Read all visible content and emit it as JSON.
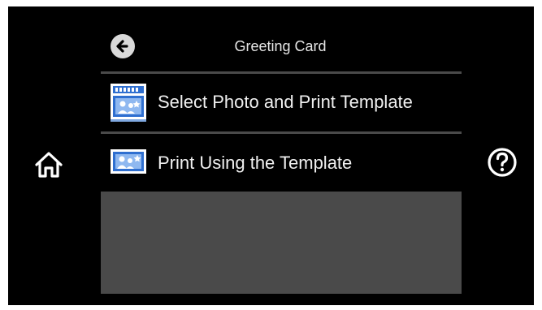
{
  "header": {
    "back_icon": "back-arrow-icon",
    "title": "Greeting Card"
  },
  "menu": {
    "items": [
      {
        "label": "Select Photo and Print Template",
        "icon": "template-select-icon"
      },
      {
        "label": "Print Using the Template",
        "icon": "template-print-icon"
      }
    ]
  },
  "nav": {
    "home_icon": "home-icon",
    "help_icon": "help-icon"
  },
  "colors": {
    "background": "#000000",
    "divider": "#4a4a4a",
    "panel": "#4a4a4a",
    "text": "#f0f0f0",
    "icon_blue": "#2f6fd0"
  }
}
